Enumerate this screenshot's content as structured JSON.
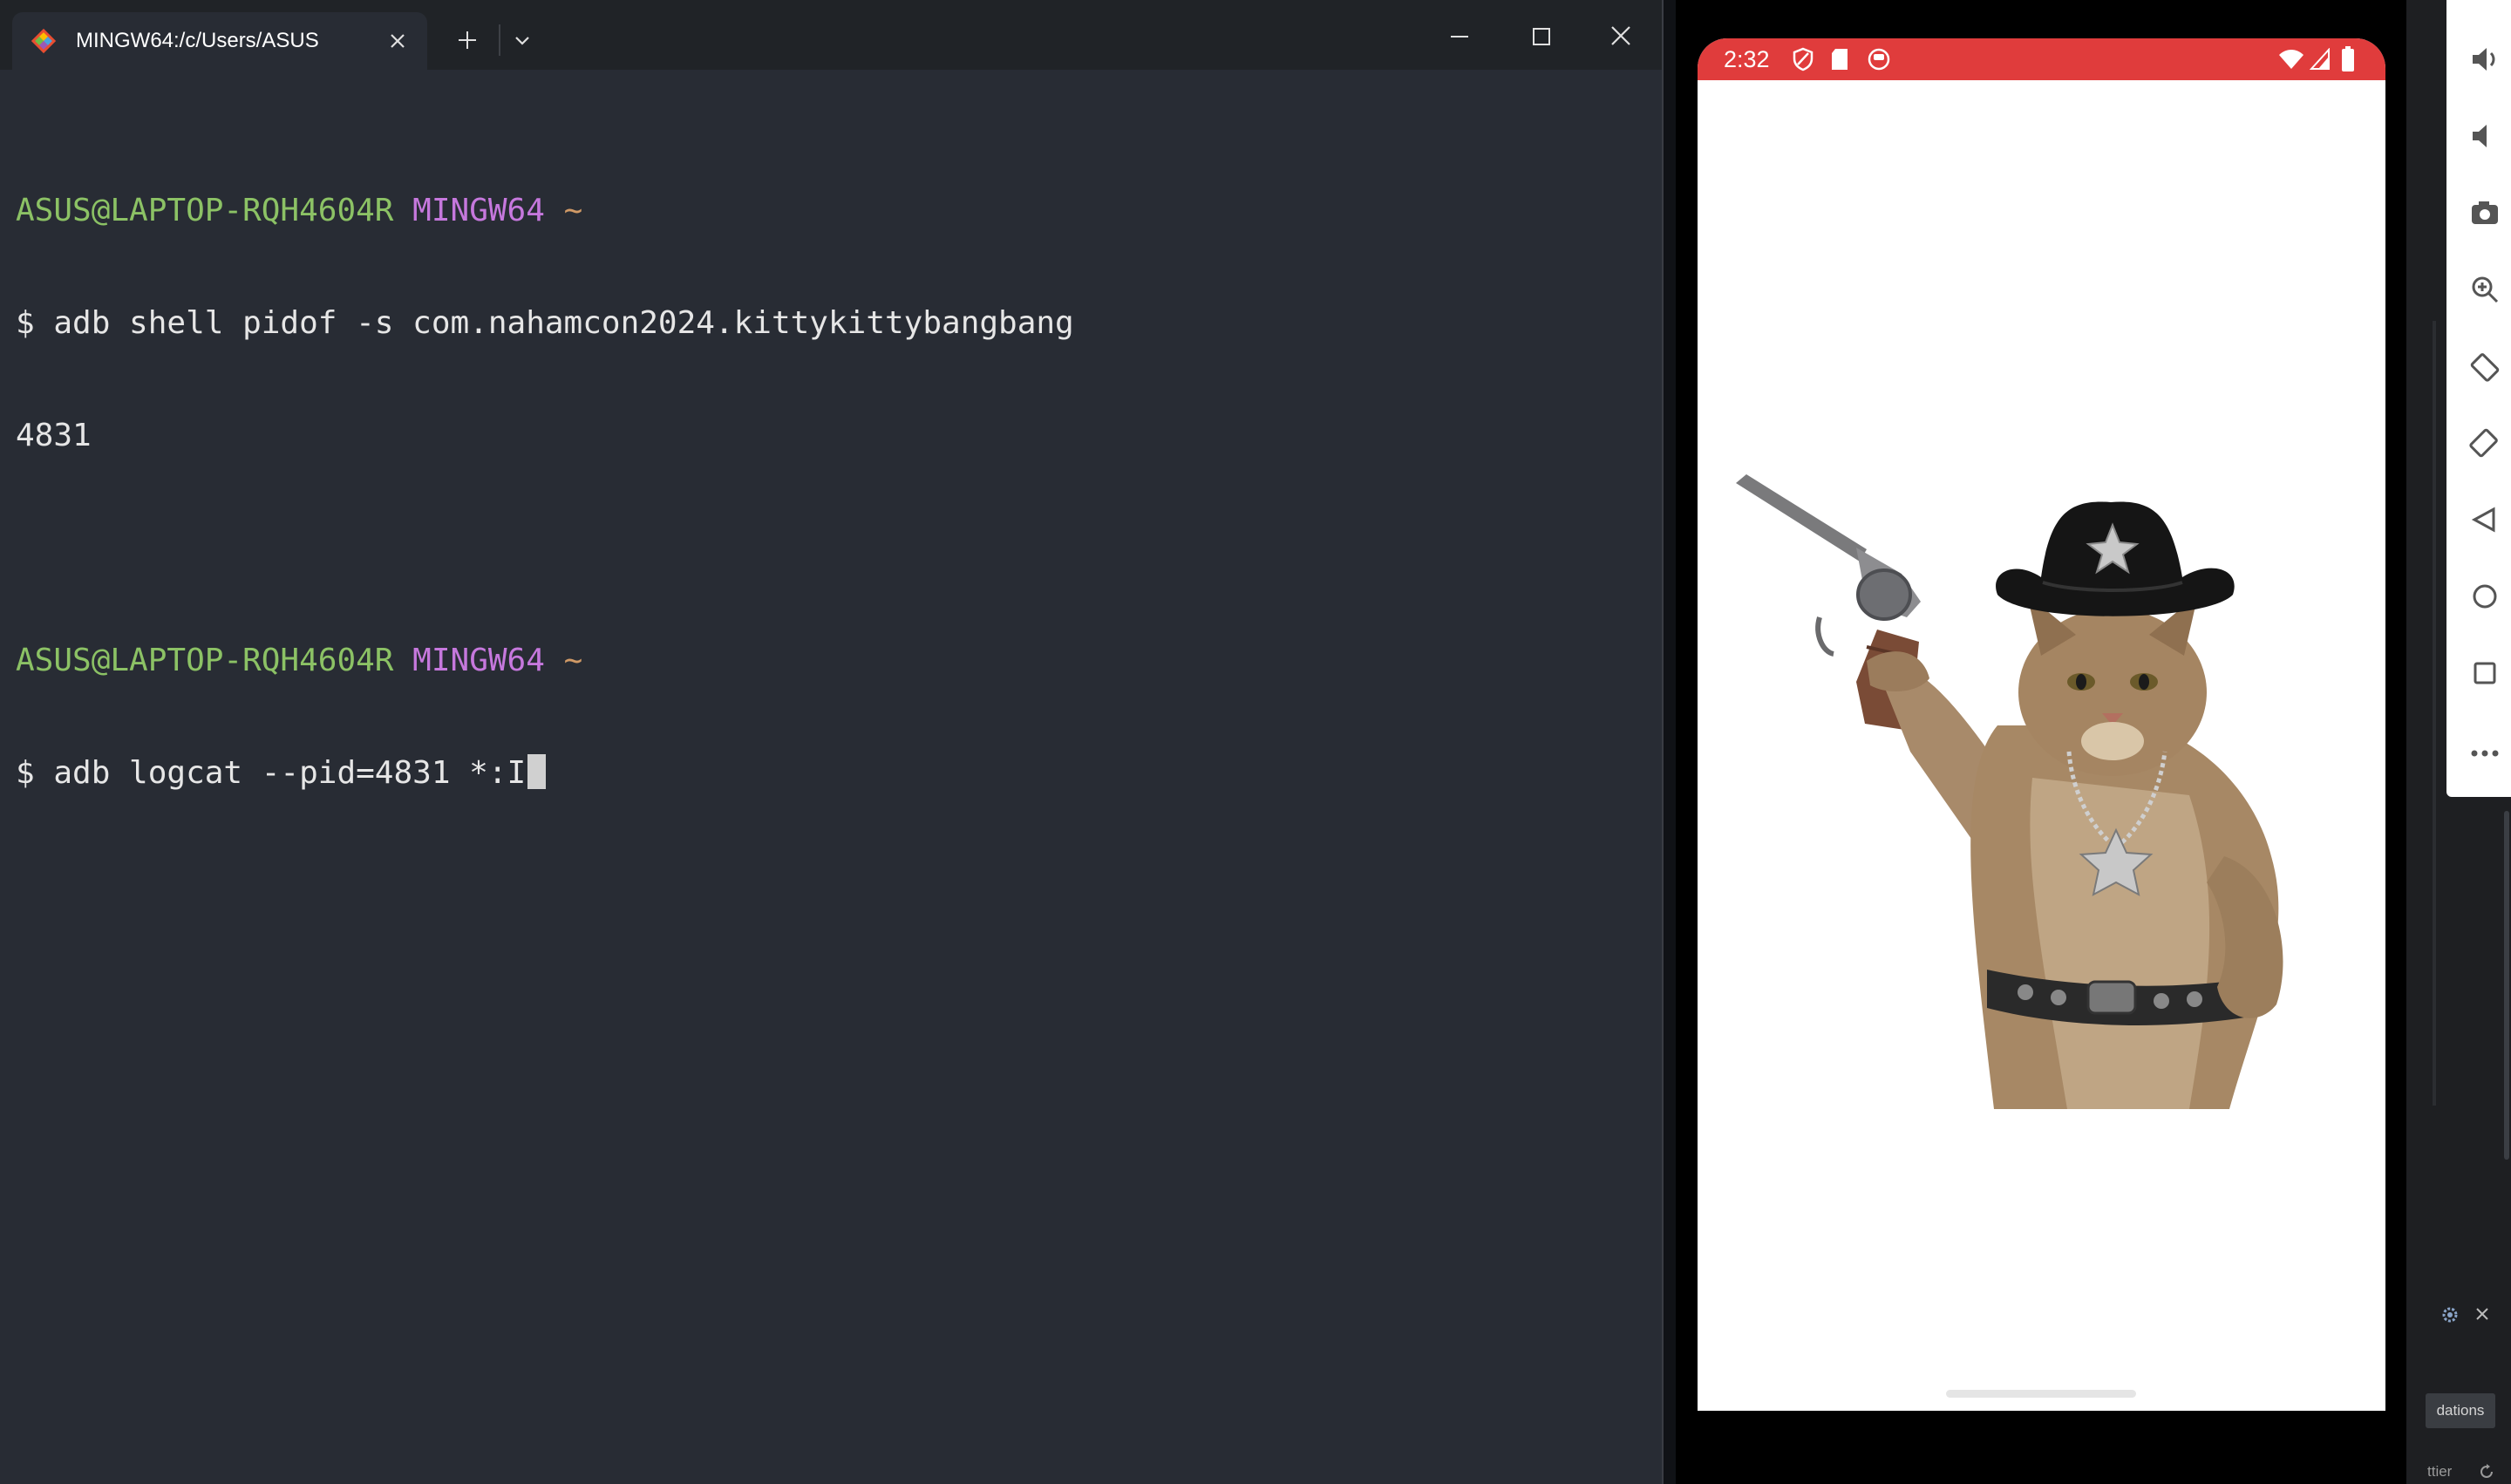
{
  "terminal": {
    "tab_title": "MINGW64:/c/Users/ASUS",
    "icons": {
      "app": "git-bash-icon",
      "tab_close": "close-icon",
      "new_tab": "plus-icon",
      "dropdown": "chevron-down-icon",
      "minimize": "minimize-icon",
      "maximize": "maximize-icon",
      "close": "close-icon"
    },
    "lines": [
      {
        "user": "ASUS@LAPTOP-RQH4604R",
        "host": "MINGW64",
        "dir": "~"
      },
      {
        "text": "$ adb shell pidof -s com.nahamcon2024.kittykittybangbang"
      },
      {
        "text": "4831"
      },
      {
        "text": ""
      },
      {
        "user": "ASUS@LAPTOP-RQH4604R",
        "host": "MINGW64",
        "dir": "~"
      },
      {
        "text": "$ adb logcat --pid=4831 *:I"
      }
    ],
    "colors": {
      "background": "#282c34",
      "user": "#8cc265",
      "host": "#c678dd",
      "tilde": "#d19a66"
    }
  },
  "emulator": {
    "status_bar": {
      "time": "2:32",
      "left_icons": [
        "shield-icon",
        "sd-card-icon",
        "app-notification-icon"
      ],
      "right_icons": [
        "wifi-icon",
        "signal-icon",
        "battery-icon"
      ],
      "color": "#e03c3c"
    },
    "app_image": "cowboy-cat-with-revolver-image",
    "nav": "gesture-handle"
  },
  "emulator_toolbar": {
    "tools": [
      "volume-up-icon",
      "volume-down-icon",
      "camera-icon",
      "zoom-icon",
      "rotate-left-icon",
      "rotate-right-icon",
      "back-icon",
      "home-icon",
      "overview-icon",
      "more-icon"
    ]
  },
  "ide_side": {
    "button_label": "dations",
    "status_label": "ttier"
  }
}
